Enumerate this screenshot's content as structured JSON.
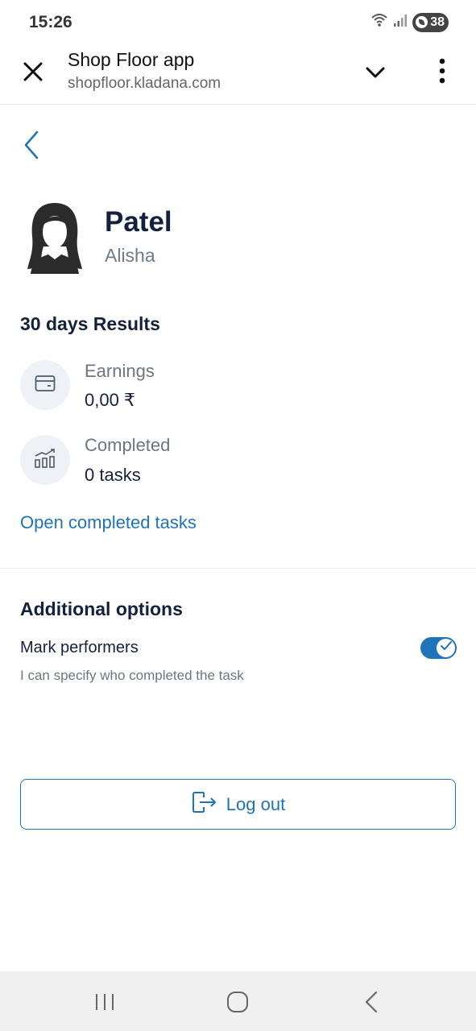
{
  "status_bar": {
    "time": "15:26",
    "battery": "38"
  },
  "header": {
    "title": "Shop Floor app",
    "url": "shopfloor.kladana.com"
  },
  "profile": {
    "last_name": "Patel",
    "first_name": "Alisha"
  },
  "results": {
    "title": "30 days Results",
    "earnings_label": "Earnings",
    "earnings_value": "0,00 ₹",
    "completed_label": "Completed",
    "completed_value": "0 tasks",
    "open_link": "Open completed tasks"
  },
  "options": {
    "title": "Additional options",
    "mark_performers_label": "Mark performers",
    "mark_performers_desc": "I can specify who completed the task",
    "mark_performers_enabled": true
  },
  "logout": {
    "label": "Log out"
  },
  "colors": {
    "accent": "#1f73b8",
    "text_dark": "#14213d",
    "text_muted": "#6c7680",
    "icon_bg": "#eef2f7"
  },
  "icons": {
    "close": "close-icon",
    "chevron": "chevron-down-icon",
    "more": "more-vertical-icon",
    "back": "back-arrow-icon",
    "wallet": "wallet-icon",
    "chart": "bar-chart-growth-icon",
    "logout": "logout-icon"
  }
}
